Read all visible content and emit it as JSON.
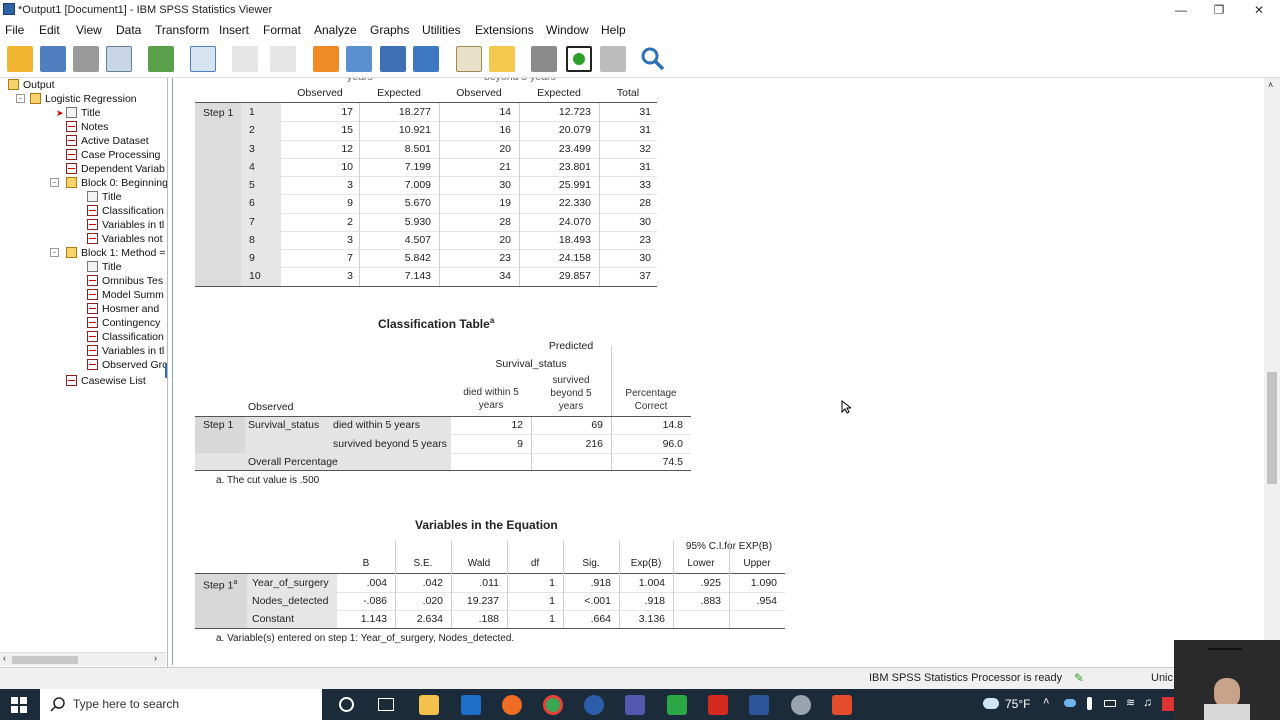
{
  "window": {
    "title": "*Output1 [Document1] - IBM SPSS Statistics Viewer"
  },
  "menu": [
    "File",
    "Edit",
    "View",
    "Data",
    "Transform",
    "Insert",
    "Format",
    "Analyze",
    "Graphs",
    "Utilities",
    "Extensions",
    "Window",
    "Help"
  ],
  "nav": {
    "items": [
      "Output",
      "Logistic Regression",
      "Title",
      "Notes",
      "Active Dataset",
      "Case Processing",
      "Dependent Variab",
      "Block 0: Beginning",
      "Title",
      "Classification",
      "Variables in tl",
      "Variables not",
      "Block 1: Method =",
      "Title",
      "Omnibus Tes",
      "Model Summ",
      "Hosmer and",
      "Contingency",
      "Classification",
      "Variables in tl",
      "Observed Grc",
      "Casewise List"
    ]
  },
  "contingency": {
    "header_partial": [
      "years",
      "beyond 5 years"
    ],
    "columns": [
      "Observed",
      "Expected",
      "Observed",
      "Expected",
      "Total"
    ],
    "step_label": "Step 1",
    "rows": [
      [
        "1",
        "17",
        "18.277",
        "14",
        "12.723",
        "31"
      ],
      [
        "2",
        "15",
        "10.921",
        "16",
        "20.079",
        "31"
      ],
      [
        "3",
        "12",
        "8.501",
        "20",
        "23.499",
        "32"
      ],
      [
        "4",
        "10",
        "7.199",
        "21",
        "23.801",
        "31"
      ],
      [
        "5",
        "3",
        "7.009",
        "30",
        "25.991",
        "33"
      ],
      [
        "6",
        "9",
        "5.670",
        "19",
        "22.330",
        "28"
      ],
      [
        "7",
        "2",
        "5.930",
        "28",
        "24.070",
        "30"
      ],
      [
        "8",
        "3",
        "4.507",
        "20",
        "18.493",
        "23"
      ],
      [
        "9",
        "7",
        "5.842",
        "23",
        "24.158",
        "30"
      ],
      [
        "10",
        "3",
        "7.143",
        "34",
        "29.857",
        "37"
      ]
    ]
  },
  "classification": {
    "title": "Classification Table",
    "title_sup": "a",
    "predicted": "Predicted",
    "survival_status": "Survival_status",
    "col1": [
      "died within 5",
      "years"
    ],
    "col2": [
      "survived",
      "beyond 5",
      "years"
    ],
    "col3": [
      "Percentage",
      "Correct"
    ],
    "observed": "Observed",
    "step": "Step 1",
    "var": "Survival_status",
    "row1": {
      "label": "died within 5 years",
      "a": "12",
      "b": "69",
      "p": "14.8"
    },
    "row2": {
      "label": "survived beyond 5 years",
      "a": "9",
      "b": "216",
      "p": "96.0"
    },
    "overall": {
      "label": "Overall Percentage",
      "p": "74.5"
    },
    "footnote": "a. The cut value is .500"
  },
  "variables": {
    "title": "Variables in the Equation",
    "ci_header": "95% C.I.for EXP(B)",
    "columns": [
      "B",
      "S.E.",
      "Wald",
      "df",
      "Sig.",
      "Exp(B)",
      "Lower",
      "Upper"
    ],
    "step": "Step 1",
    "step_sup": "a",
    "rows": [
      [
        "Year_of_surgery",
        ".004",
        ".042",
        ".011",
        "1",
        ".918",
        "1.004",
        ".925",
        "1.090"
      ],
      [
        "Nodes_detected",
        "-.086",
        ".020",
        "19.237",
        "1",
        "<.001",
        ".918",
        ".883",
        ".954"
      ],
      [
        "Constant",
        "1.143",
        "2.634",
        ".188",
        "1",
        ".664",
        "3.136",
        "",
        ""
      ]
    ],
    "footnote": "a. Variable(s) entered on step 1: Year_of_surgery, Nodes_detected."
  },
  "status": {
    "processor": "IBM SPSS Statistics Processor is ready",
    "unicode": "Unic"
  },
  "taskbar": {
    "search_placeholder": "Type here to search",
    "temp": "75°F"
  }
}
